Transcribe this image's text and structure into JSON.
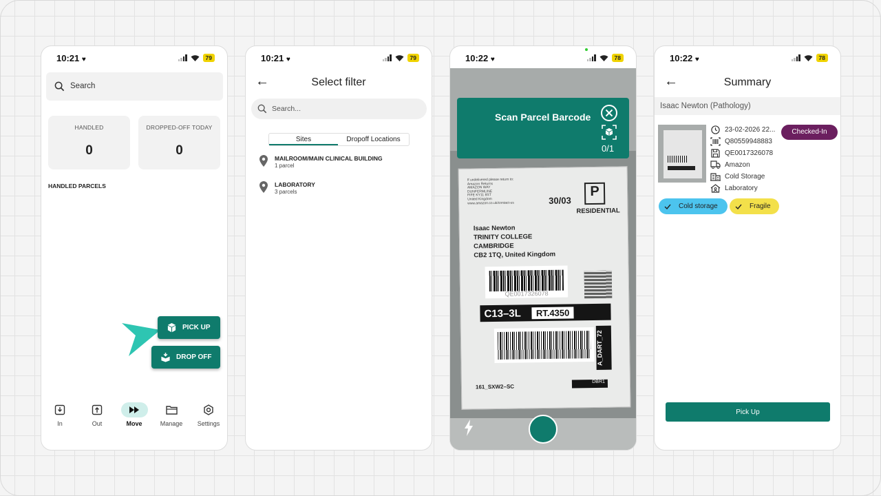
{
  "screens": {
    "home": {
      "time": "10:21",
      "battery": "79",
      "search_placeholder": "Search",
      "stats": [
        {
          "label": "HANDLED",
          "value": "0"
        },
        {
          "label": "DROPPED-OFF TODAY",
          "value": "0"
        }
      ],
      "section_title": "HANDLED PARCELS",
      "pickup_label": "PICK UP",
      "dropoff_label": "DROP OFF",
      "nav": [
        {
          "label": "In",
          "icon": "inbox-in-icon"
        },
        {
          "label": "Out",
          "icon": "inbox-out-icon"
        },
        {
          "label": "Move",
          "icon": "fast-forward-icon",
          "active": true
        },
        {
          "label": "Manage",
          "icon": "folder-icon"
        },
        {
          "label": "Settings",
          "icon": "hexagon-settings-icon"
        }
      ]
    },
    "filter": {
      "time": "10:21",
      "battery": "79",
      "title": "Select filter",
      "search_placeholder": "Search...",
      "tabs": [
        "Sites",
        "Dropoff Locations"
      ],
      "active_tab": "Sites",
      "locations": [
        {
          "name": "MAILROOM/MAIN CLINICAL BUILDING",
          "count": "1 parcel"
        },
        {
          "name": "LABORATORY",
          "count": "3 parcels"
        }
      ]
    },
    "scan": {
      "time": "10:22",
      "battery": "78",
      "title": "Scan Parcel Barcode",
      "progress": "0/1",
      "label_text": {
        "return_lines": [
          "If undelivered please return to:",
          "Amazon Returns",
          "AMAZON WAY",
          "DUNFERMLINE",
          "FIFE KY11 8ST",
          "United Kingdom",
          "www.amazon.co.uk/contact-us"
        ],
        "date": "30/03",
        "badge_letter": "P",
        "badge_text": "RESIDENTIAL",
        "address": [
          "Isaac Newton",
          "TRINITY COLLEGE",
          "CAMBRIDGE",
          "CB2 1TQ, United Kingdom"
        ],
        "barcode_number": "QE0017326078",
        "route": "C13–3L",
        "rt": "RT.4350",
        "side": "A_DART_72",
        "bottom_left": "161_SXW2–SC",
        "dbr": "DBR1"
      }
    },
    "summary": {
      "time": "10:22",
      "battery": "78",
      "title": "Summary",
      "recipient": "Isaac Newton (Pathology)",
      "status": "Checked-In",
      "details": [
        {
          "icon": "clock-icon",
          "text": "23-02-2026 22..."
        },
        {
          "icon": "barcode-icon",
          "text": "Q80559948883"
        },
        {
          "icon": "save-icon",
          "text": "QE0017326078"
        },
        {
          "icon": "truck-icon",
          "text": "Amazon"
        },
        {
          "icon": "building-icon",
          "text": "Cold Storage"
        },
        {
          "icon": "home-user-icon",
          "text": "Laboratory"
        }
      ],
      "tags": [
        {
          "label": "Cold storage",
          "color": "#4cc4ee"
        },
        {
          "label": "Fragile",
          "color": "#f3e04a"
        }
      ],
      "action_label": "Pick Up"
    }
  },
  "colors": {
    "primary": "#0f7b6c",
    "status_purple": "#6b1f5f",
    "arrow": "#2ec5b2"
  }
}
